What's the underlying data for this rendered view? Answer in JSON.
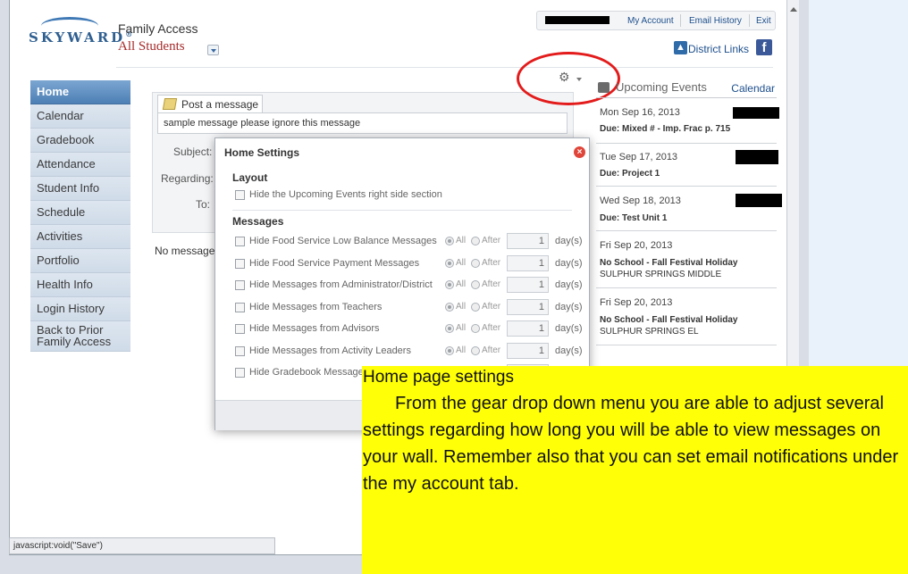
{
  "header": {
    "logo_text": "SKYWARD",
    "app_title": "Family Access",
    "students_selector": "All Students",
    "top_links": [
      "My Account",
      "Email History",
      "Exit"
    ],
    "district_links": "District Links"
  },
  "nav": {
    "items": [
      {
        "label": "Home",
        "active": true
      },
      {
        "label": "Calendar"
      },
      {
        "label": "Gradebook"
      },
      {
        "label": "Attendance"
      },
      {
        "label": "Student Info"
      },
      {
        "label": "Schedule"
      },
      {
        "label": "Activities"
      },
      {
        "label": "Portfolio"
      },
      {
        "label": "Health Info"
      },
      {
        "label": "Login History"
      },
      {
        "label": "Back to Prior Family Access"
      }
    ]
  },
  "post": {
    "tab_label": "Post a message",
    "message_value": "sample message please ignore this message",
    "subject_label": "Subject:",
    "regarding_label": "Regarding:",
    "to_label": "To:",
    "no_messages": "No messages"
  },
  "events": {
    "title": "Upcoming Events",
    "calendar_link": "Calendar",
    "items": [
      {
        "date": "Mon Sep 16, 2013",
        "title": "Due: Mixed # - Imp. Frac p. 715",
        "sub": ""
      },
      {
        "date": "Tue Sep 17, 2013",
        "title": "Due: Project 1",
        "sub": ""
      },
      {
        "date": "Wed Sep 18, 2013",
        "title": "Due: Test Unit 1",
        "sub": ""
      },
      {
        "date": "Fri Sep 20, 2013",
        "title": "No School - Fall Festival Holiday",
        "sub": "SULPHUR SPRINGS MIDDLE"
      },
      {
        "date": "Fri Sep 20, 2013",
        "title": "No School - Fall Festival Holiday",
        "sub": "SULPHUR SPRINGS EL"
      }
    ]
  },
  "modal": {
    "title": "Home Settings",
    "layout_heading": "Layout",
    "layout_option": "Hide the Upcoming Events right side section",
    "messages_heading": "Messages",
    "radio_all": "All",
    "radio_after": "After",
    "days_label": "day(s)",
    "rows": [
      {
        "label": "Hide Food Service Low Balance Messages",
        "days": "1"
      },
      {
        "label": "Hide Food Service Payment Messages",
        "days": "1"
      },
      {
        "label": "Hide Messages from Administrator/District",
        "days": "1"
      },
      {
        "label": "Hide Messages from Teachers",
        "days": "1"
      },
      {
        "label": "Hide Messages from Advisors",
        "days": "1"
      },
      {
        "label": "Hide Messages from Activity Leaders",
        "days": "1"
      },
      {
        "label": "Hide Gradebook Messages",
        "days": ""
      }
    ]
  },
  "note": {
    "title": "Home page settings",
    "body": "From the gear drop down menu you are able to adjust several settings regarding how long you will be able to view messages on your wall.  Remember also that you can set email notifications under the my account tab."
  },
  "status_bar": "javascript:void(\"Save\")",
  "colors": {
    "accent": "#4d7fb5",
    "highlight": "#ffff08",
    "annotation_circle": "#e31b1b"
  }
}
